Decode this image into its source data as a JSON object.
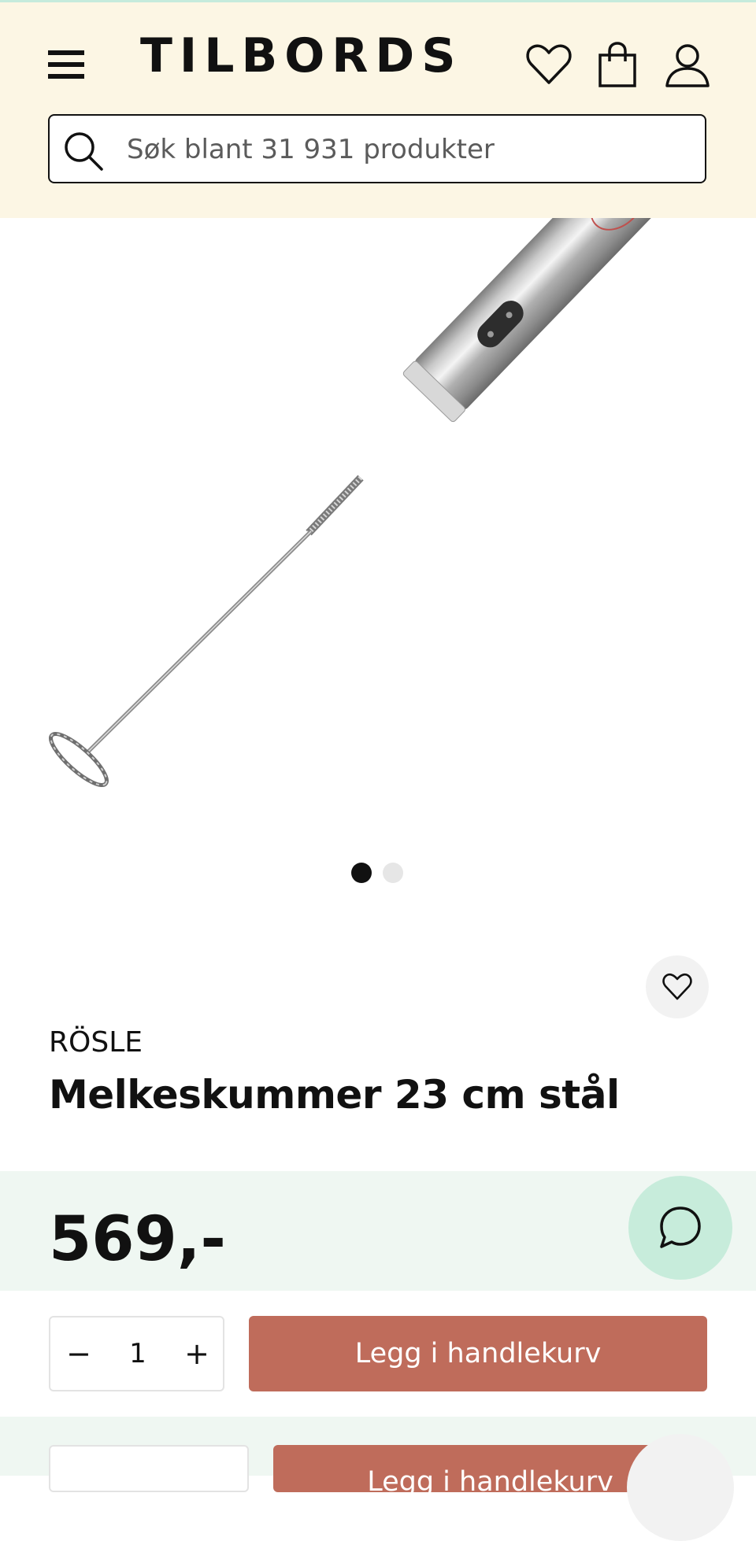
{
  "header": {
    "logo_text": "TILBORDS",
    "menu_icon": "hamburger-menu-icon",
    "wishlist_icon": "heart-icon",
    "cart_icon": "shopping-bag-icon",
    "account_icon": "user-icon",
    "background_color": "#fcf6e4"
  },
  "search": {
    "placeholder": "Søk blant 31 931 produkter",
    "icon": "search-icon"
  },
  "gallery": {
    "image_count": 2,
    "active_index": 1
  },
  "product": {
    "brand": "RÖSLE",
    "title": "Melkeskummer 23 cm stål",
    "price": "569,-",
    "wishlist_icon": "heart-icon"
  },
  "purchase": {
    "quantity": "1",
    "minus_symbol": "−",
    "plus_symbol": "+",
    "add_to_cart_label": "Legg i handlekurv",
    "button_color": "#bf6c5b"
  },
  "chat": {
    "icon": "chat-bubble-icon",
    "background_color": "#c7ecdb"
  },
  "sticky_bar": {
    "add_to_cart_label": "Legg i handlekurv"
  }
}
